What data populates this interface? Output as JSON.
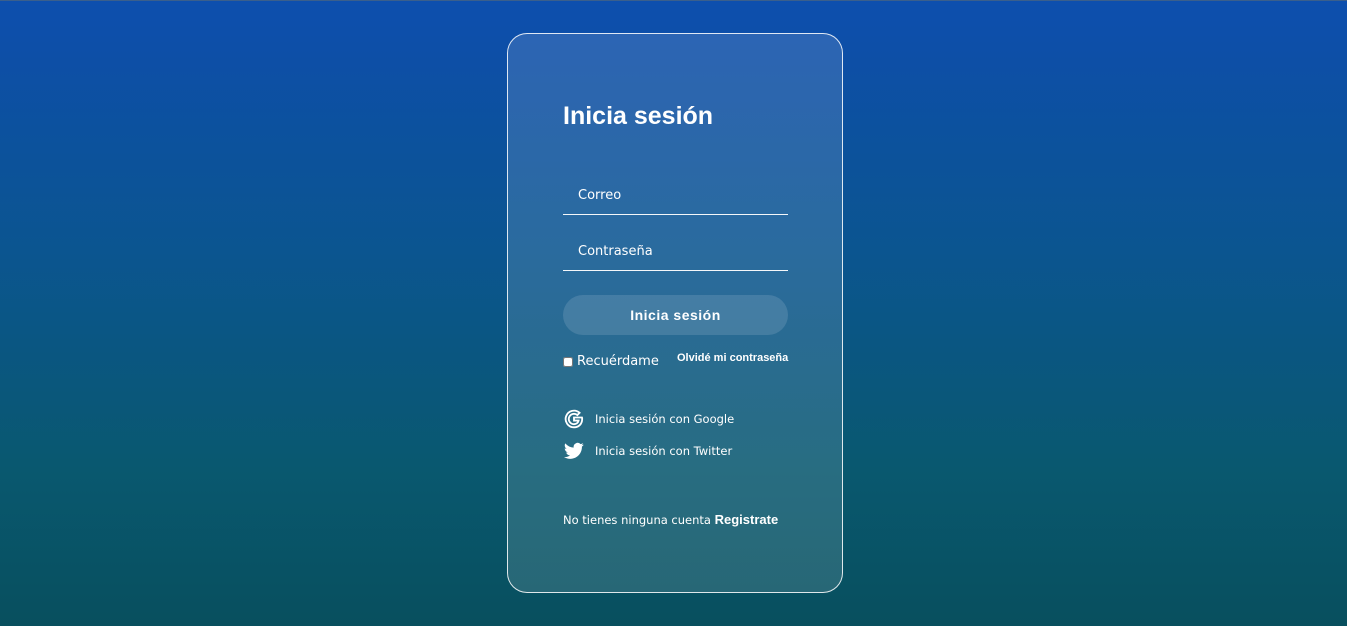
{
  "login": {
    "title": "Inicia sesión",
    "email_placeholder": "Correo",
    "password_placeholder": "Contraseña",
    "submit_label": "Inicia sesión",
    "remember_label": "Recuérdame",
    "forgot_label": "Olvidé mi contraseña",
    "google_label": "Inicia sesión con Google",
    "twitter_label": "Inicia sesión con Twitter",
    "no_account_text": "No tienes ninguna cuenta ",
    "register_label": "Registrate"
  },
  "icons": {
    "google": "google-icon",
    "twitter": "twitter-icon"
  },
  "colors": {
    "background_top": "#0d4fae",
    "background_bottom": "#084f5e",
    "text": "#ffffff"
  }
}
